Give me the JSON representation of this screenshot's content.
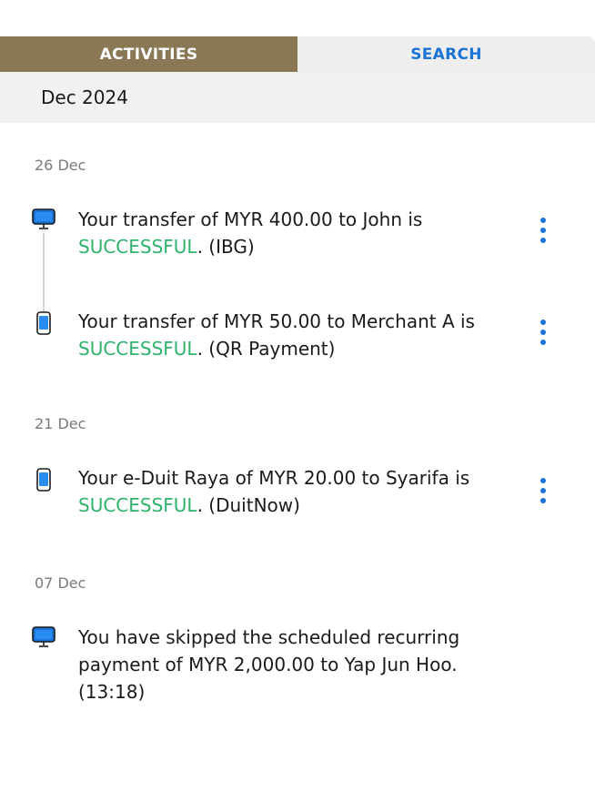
{
  "tabs": [
    {
      "label": "ACTIVITIES",
      "active": true
    },
    {
      "label": "SEARCH",
      "active": false
    }
  ],
  "month": "Dec 2024",
  "colors": {
    "accent": "#8a7754",
    "link": "#1b73d6",
    "success": "#2fb36c"
  },
  "groups": [
    {
      "date": "26 Dec",
      "items": [
        {
          "icon": "desktop-icon",
          "pre": "Your transfer of MYR 400.00 to John is ",
          "status": "SUCCESSFUL",
          "post": ". (IBG)",
          "has_more": true
        },
        {
          "icon": "mobile-icon",
          "pre": "Your transfer of MYR 50.00 to Merchant A is ",
          "status": "SUCCESSFUL",
          "post": ". (QR Payment)",
          "has_more": true
        }
      ]
    },
    {
      "date": "21 Dec",
      "items": [
        {
          "icon": "mobile-icon",
          "pre": "Your e-Duit Raya of MYR 20.00 to Syarifa is ",
          "status": "SUCCESSFUL",
          "post": ". (DuitNow)",
          "has_more": true
        }
      ]
    },
    {
      "date": "07 Dec",
      "items": [
        {
          "icon": "desktop-icon",
          "pre": "You have skipped the scheduled recurring payment of MYR 2,000.00 to Yap Jun Hoo. (13:18)",
          "status": "",
          "post": "",
          "has_more": false
        }
      ]
    }
  ]
}
